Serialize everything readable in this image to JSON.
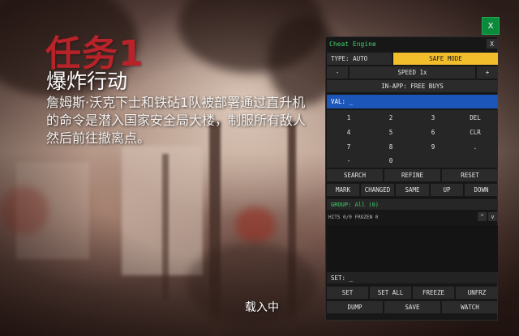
{
  "mission": {
    "title": "任务1",
    "subtitle": "爆炸行动",
    "description": "詹姆斯·沃克下士和铁砧1队被部署通过直升机\n的命令是潜入国家安全局大楼，制服所有敌人\n然后前往撤离点。"
  },
  "loading": "载入中",
  "corner_close": "X",
  "cheat_engine": {
    "title": "Cheat Engine",
    "close": "X",
    "type_label": "TYPE: AUTO",
    "safe_mode": "SAFE MODE",
    "speed_minus": "-",
    "speed_label": "SPEED 1x",
    "speed_plus": "+",
    "in_app": "IN-APP: FREE BUYS",
    "val_label": "VAL: _",
    "keypad": [
      [
        "1",
        "2",
        "3",
        "DEL"
      ],
      [
        "4",
        "5",
        "6",
        "CLR"
      ],
      [
        "7",
        "8",
        "9",
        "."
      ],
      [
        "-",
        "0"
      ]
    ],
    "actions1": [
      "SEARCH",
      "REFINE",
      "RESET"
    ],
    "actions2": [
      "MARK",
      "CHANGED",
      "SAME",
      "UP",
      "DOWN"
    ],
    "group_label": "GROUP: All (0)",
    "hits_label": "HITS 0/0 FROZEN 0",
    "scroll_up": "^",
    "scroll_down": "v",
    "set_label": "SET: _",
    "actions3": [
      "SET",
      "SET ALL",
      "FREEZE",
      "UNFRZ"
    ],
    "actions4": [
      "DUMP",
      "SAVE",
      "WATCH"
    ],
    "colors": {
      "accent_green": "#3fd36a",
      "safe_mode_yellow": "#f2be2c",
      "val_blue": "#1c56b8",
      "close_green": "#0c8a3c",
      "title_red": "#b8232a"
    }
  }
}
